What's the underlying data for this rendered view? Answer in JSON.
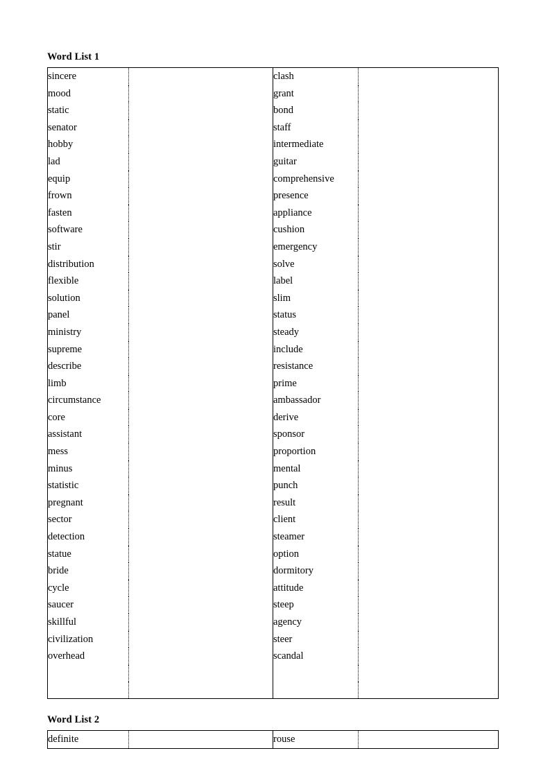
{
  "document": {
    "page_background": "#ffffff",
    "text_color": "#000000",
    "border_color": "#000000"
  },
  "sections": [
    {
      "title": "Word List 1",
      "table": {
        "column_roles": [
          "word",
          "blank",
          "word",
          "blank"
        ],
        "rows": [
          {
            "word_a": "sincere",
            "blank_a": "",
            "word_b": "clash",
            "blank_b": ""
          },
          {
            "word_a": "mood",
            "blank_a": "",
            "word_b": "grant",
            "blank_b": ""
          },
          {
            "word_a": "static",
            "blank_a": "",
            "word_b": "bond",
            "blank_b": ""
          },
          {
            "word_a": "senator",
            "blank_a": "",
            "word_b": "staff",
            "blank_b": ""
          },
          {
            "word_a": "hobby",
            "blank_a": "",
            "word_b": "intermediate",
            "blank_b": ""
          },
          {
            "word_a": "lad",
            "blank_a": "",
            "word_b": "guitar",
            "blank_b": ""
          },
          {
            "word_a": "equip",
            "blank_a": "",
            "word_b": "comprehensive",
            "blank_b": ""
          },
          {
            "word_a": "frown",
            "blank_a": "",
            "word_b": "presence",
            "blank_b": ""
          },
          {
            "word_a": "fasten",
            "blank_a": "",
            "word_b": "appliance",
            "blank_b": ""
          },
          {
            "word_a": "software",
            "blank_a": "",
            "word_b": "cushion",
            "blank_b": ""
          },
          {
            "word_a": "stir",
            "blank_a": "",
            "word_b": "emergency",
            "blank_b": ""
          },
          {
            "word_a": "distribution",
            "blank_a": "",
            "word_b": "solve",
            "blank_b": ""
          },
          {
            "word_a": "flexible",
            "blank_a": "",
            "word_b": "label",
            "blank_b": ""
          },
          {
            "word_a": "solution",
            "blank_a": "",
            "word_b": "slim",
            "blank_b": ""
          },
          {
            "word_a": "panel",
            "blank_a": "",
            "word_b": "status",
            "blank_b": ""
          },
          {
            "word_a": "ministry",
            "blank_a": "",
            "word_b": "steady",
            "blank_b": ""
          },
          {
            "word_a": "supreme",
            "blank_a": "",
            "word_b": "include",
            "blank_b": ""
          },
          {
            "word_a": "describe",
            "blank_a": "",
            "word_b": "resistance",
            "blank_b": ""
          },
          {
            "word_a": "limb",
            "blank_a": "",
            "word_b": "prime",
            "blank_b": ""
          },
          {
            "word_a": "circumstance",
            "blank_a": "",
            "word_b": "ambassador",
            "blank_b": ""
          },
          {
            "word_a": "core",
            "blank_a": "",
            "word_b": "derive",
            "blank_b": ""
          },
          {
            "word_a": "assistant",
            "blank_a": "",
            "word_b": "sponsor",
            "blank_b": ""
          },
          {
            "word_a": "mess",
            "blank_a": "",
            "word_b": "proportion",
            "blank_b": ""
          },
          {
            "word_a": "minus",
            "blank_a": "",
            "word_b": "mental",
            "blank_b": ""
          },
          {
            "word_a": "statistic",
            "blank_a": "",
            "word_b": "punch",
            "blank_b": ""
          },
          {
            "word_a": "pregnant",
            "blank_a": "",
            "word_b": "result",
            "blank_b": ""
          },
          {
            "word_a": "sector",
            "blank_a": "",
            "word_b": "client",
            "blank_b": ""
          },
          {
            "word_a": "detection",
            "blank_a": "",
            "word_b": "steamer",
            "blank_b": ""
          },
          {
            "word_a": "statue",
            "blank_a": "",
            "word_b": "option",
            "blank_b": ""
          },
          {
            "word_a": "bride",
            "blank_a": "",
            "word_b": "dormitory",
            "blank_b": ""
          },
          {
            "word_a": "cycle",
            "blank_a": "",
            "word_b": "attitude",
            "blank_b": ""
          },
          {
            "word_a": "saucer",
            "blank_a": "",
            "word_b": "steep",
            "blank_b": ""
          },
          {
            "word_a": "skillful",
            "blank_a": "",
            "word_b": "agency",
            "blank_b": ""
          },
          {
            "word_a": "civilization",
            "blank_a": "",
            "word_b": "steer",
            "blank_b": ""
          },
          {
            "word_a": "overhead",
            "blank_a": "",
            "word_b": "scandal",
            "blank_b": ""
          },
          {
            "word_a": "",
            "blank_a": "",
            "word_b": "",
            "blank_b": ""
          },
          {
            "word_a": "",
            "blank_a": "",
            "word_b": "",
            "blank_b": ""
          }
        ]
      }
    },
    {
      "title": "Word List 2",
      "table": {
        "column_roles": [
          "word",
          "blank",
          "word",
          "blank"
        ],
        "rows": [
          {
            "word_a": "definite",
            "blank_a": "",
            "word_b": "rouse",
            "blank_b": ""
          }
        ]
      }
    }
  ]
}
